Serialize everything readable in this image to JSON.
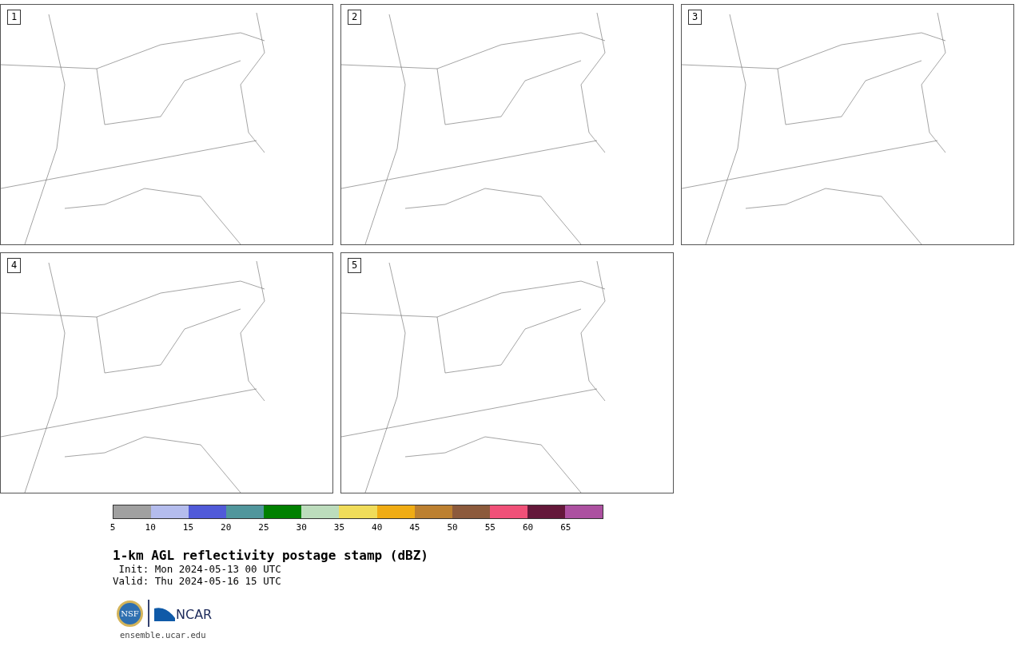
{
  "panels": [
    {
      "number": "1"
    },
    {
      "number": "2"
    },
    {
      "number": "3"
    },
    {
      "number": "4"
    },
    {
      "number": "5"
    }
  ],
  "colorbar": {
    "segments": [
      {
        "color": "#a0a0a0",
        "label": "5"
      },
      {
        "color": "#b4bced",
        "label": "10"
      },
      {
        "color": "#505ad8",
        "label": "15"
      },
      {
        "color": "#50969c",
        "label": "20"
      },
      {
        "color": "#008000",
        "label": "25"
      },
      {
        "color": "#bcdcbc",
        "label": "30"
      },
      {
        "color": "#f0dc5a",
        "label": "35"
      },
      {
        "color": "#f0ac14",
        "label": "40"
      },
      {
        "color": "#bc8030",
        "label": "45"
      },
      {
        "color": "#8c5a3c",
        "label": "50"
      },
      {
        "color": "#f05078",
        "label": "55"
      },
      {
        "color": "#64183a",
        "label": "60"
      },
      {
        "color": "#ac50a0",
        "label": "65"
      }
    ]
  },
  "title": "1-km AGL reflectivity postage stamp (dBZ)",
  "init": " Init: Mon 2024-05-13 00 UTC",
  "valid": "Valid: Thu 2024-05-16 15 UTC",
  "logos": [
    "NSF",
    "NCAR"
  ],
  "footer": "ensemble.ucar.edu"
}
